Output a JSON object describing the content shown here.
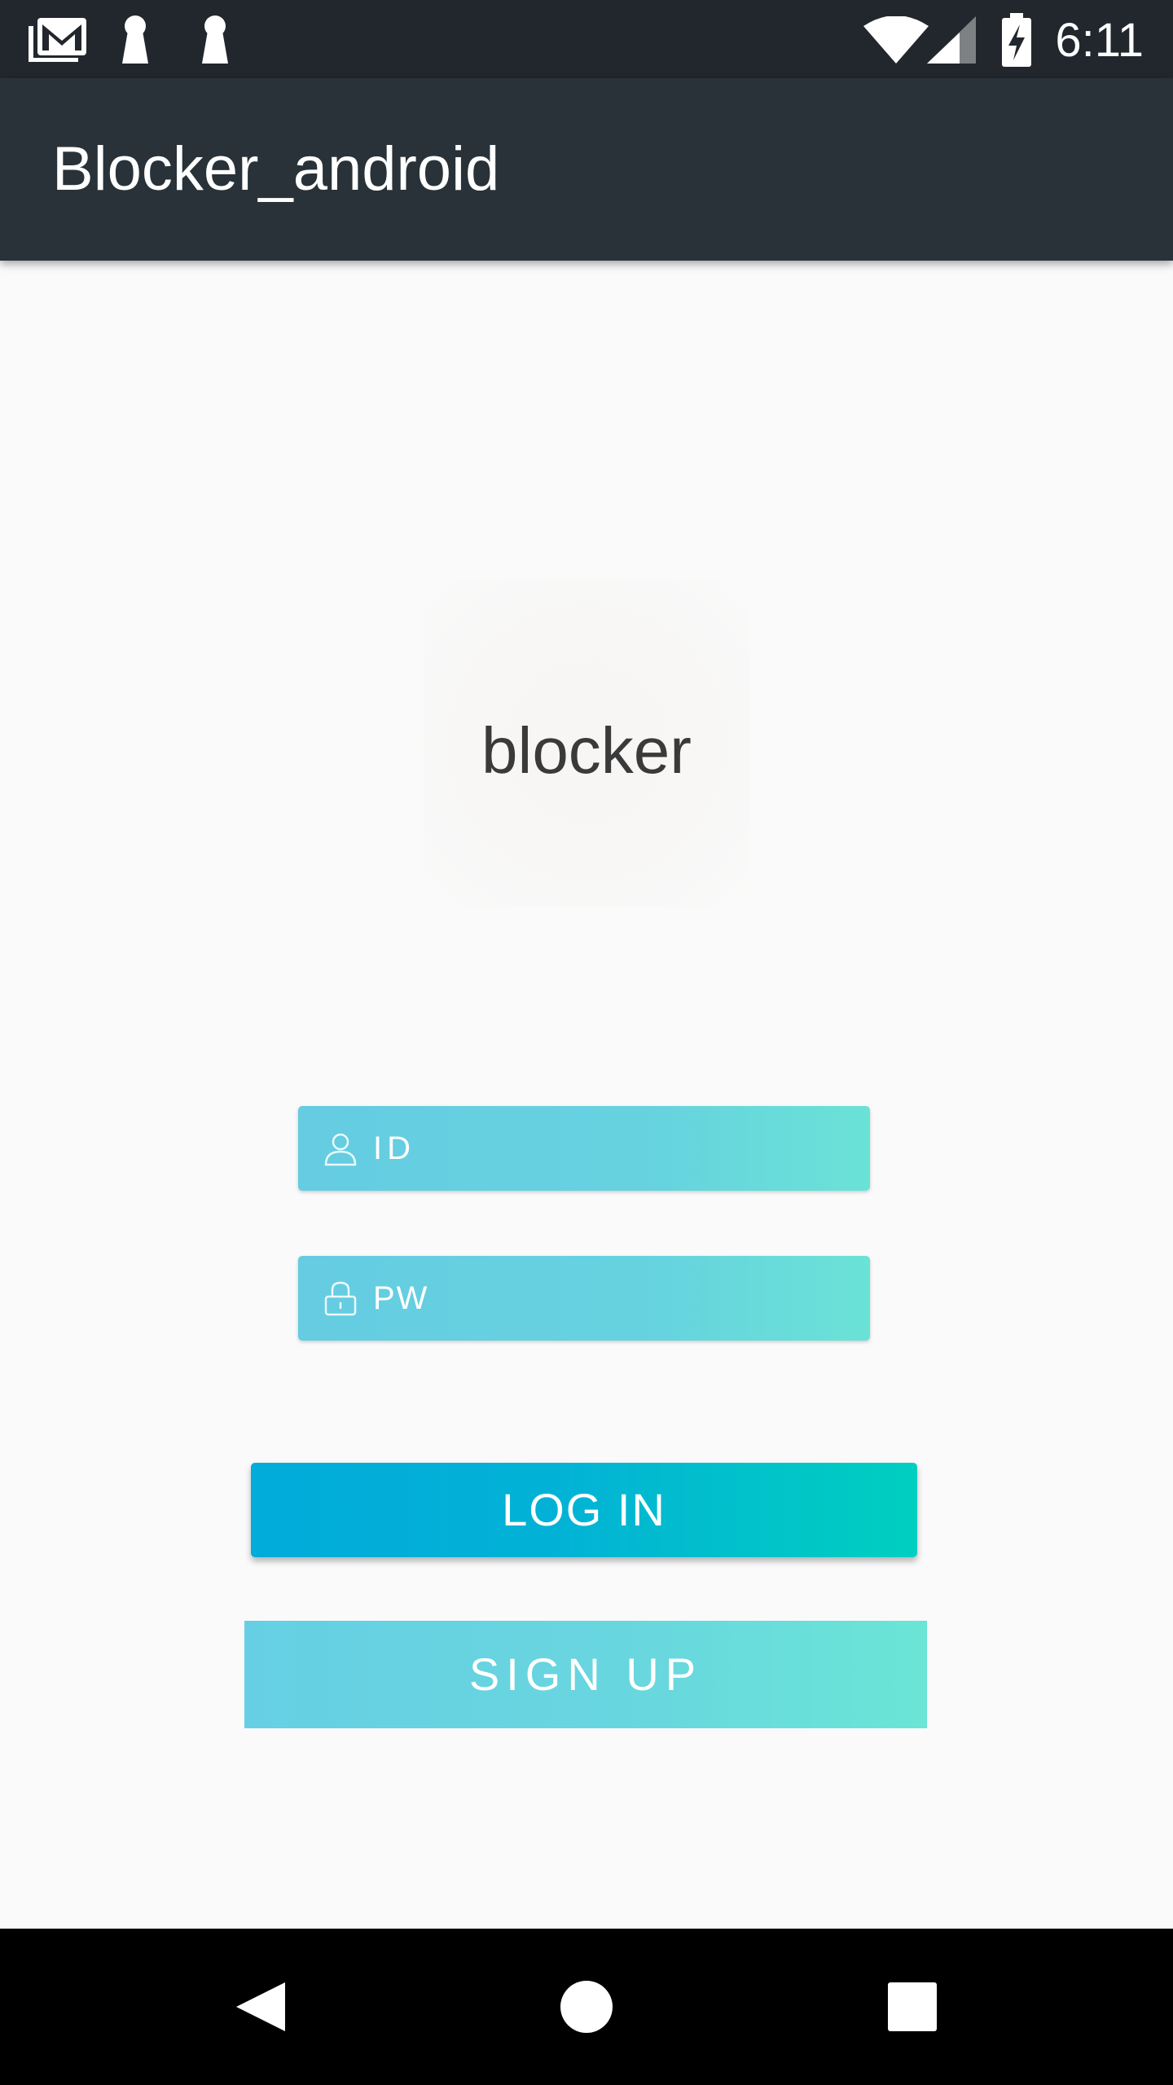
{
  "status_bar": {
    "time": "6:11",
    "icons": [
      "gmail-icon",
      "keyhole-icon",
      "keyhole-icon",
      "wifi-icon",
      "cell-signal-icon",
      "battery-charging-icon"
    ]
  },
  "app_bar": {
    "title": "Blocker_android"
  },
  "logo": {
    "text": "blocker"
  },
  "form": {
    "id_placeholder": "ID",
    "pw_placeholder": "PW",
    "login_label": "LOG IN",
    "signup_label": "SIGN UP"
  },
  "nav_bar": {
    "buttons": [
      "back-icon",
      "home-icon",
      "recents-icon"
    ]
  },
  "colors": {
    "status_bar": "#21272d",
    "app_bar": "#283238",
    "field_start": "#65cce2",
    "field_end": "#6ae2d6",
    "login_start": "#01abda",
    "login_end": "#00cfc0"
  }
}
